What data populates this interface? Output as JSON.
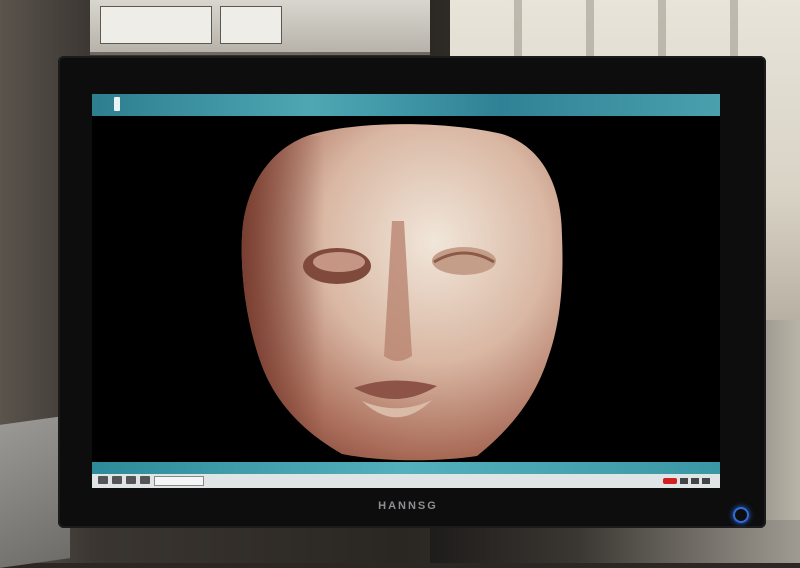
{
  "monitor": {
    "brand": "HANNSG"
  },
  "viewer": {
    "image_subject": "stone-head-sculpture"
  },
  "colors": {
    "titlebar": "#3f9aa8",
    "power_led": "#2f6de0",
    "record": "#d02020"
  }
}
